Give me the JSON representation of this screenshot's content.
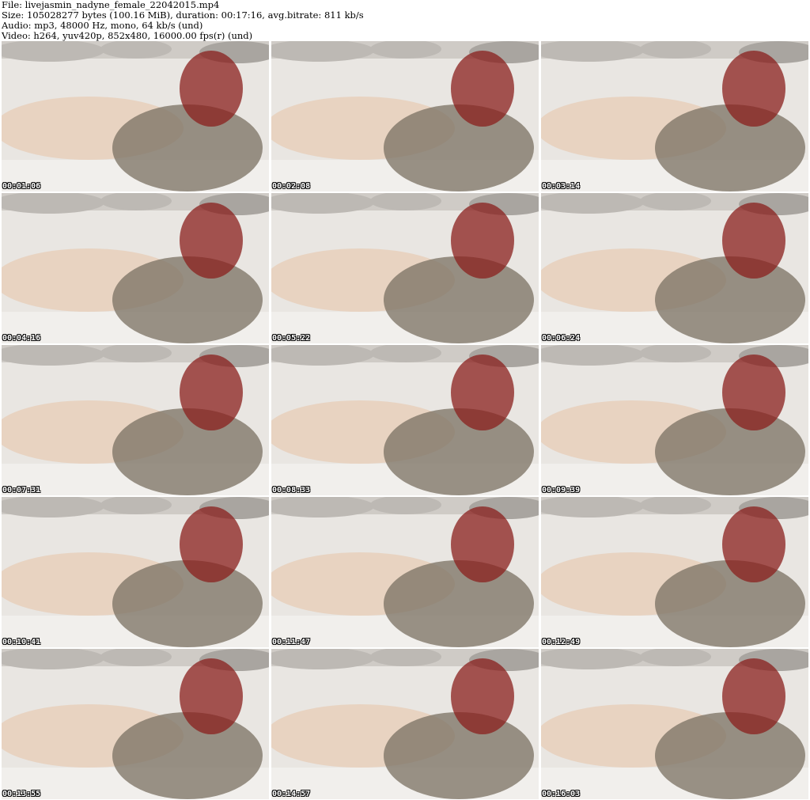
{
  "header": {
    "file": "File: livejasmin_nadyne_female_22042015.mp4",
    "size": "Size: 105028277 bytes (100.16 MiB), duration: 00:17:16, avg.bitrate: 811 kb/s",
    "audio": "Audio: mp3, 48000 Hz, mono, 64 kb/s (und)",
    "video": "Video: h264, yuv420p, 852x480, 16000.00 fps(r) (und)"
  },
  "thumbnails": [
    {
      "timestamp": "00:01:06"
    },
    {
      "timestamp": "00:02:08"
    },
    {
      "timestamp": "00:03:14"
    },
    {
      "timestamp": "00:04:16"
    },
    {
      "timestamp": "00:05:22"
    },
    {
      "timestamp": "00:06:24"
    },
    {
      "timestamp": "00:07:31"
    },
    {
      "timestamp": "00:08:33"
    },
    {
      "timestamp": "00:09:39"
    },
    {
      "timestamp": "00:10:41"
    },
    {
      "timestamp": "00:11:47"
    },
    {
      "timestamp": "00:12:49"
    },
    {
      "timestamp": "00:13:55"
    },
    {
      "timestamp": "00:14:57"
    },
    {
      "timestamp": "00:16:03"
    }
  ],
  "colors": {
    "sheet": "#e9e6e2",
    "pillow": "#bdb9b4",
    "skin": "#e8c2a5",
    "dress": "#7a7062",
    "hair": "#8a1f1c",
    "background": "#ffffff"
  }
}
